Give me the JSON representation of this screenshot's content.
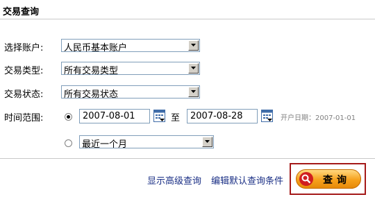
{
  "header": {
    "title": "交易查询"
  },
  "form": {
    "account": {
      "label": "选择账户:",
      "value": "人民币基本账户"
    },
    "type": {
      "label": "交易类型:",
      "value": "所有交易类型"
    },
    "status": {
      "label": "交易状态:",
      "value": "所有交易状态"
    },
    "range": {
      "label": "时间范围:",
      "start": "2007-08-01",
      "to": "至",
      "end": "2007-08-28",
      "open_date": "开户日期：2007-01-01",
      "recent": "最近一个月"
    }
  },
  "footer": {
    "advanced": "显示高级查询",
    "edit_default": "编辑默认查询条件",
    "query": "查询"
  },
  "colors": {
    "link": "#1a2f85",
    "button": "#f6a11c",
    "button_frame": "#a41818"
  }
}
